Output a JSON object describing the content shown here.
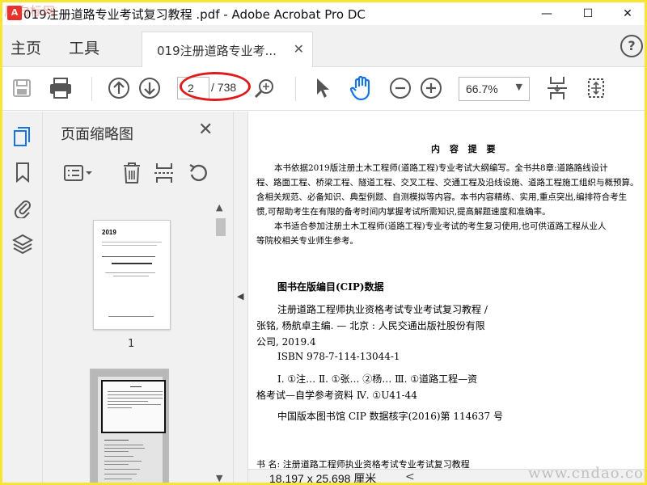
{
  "window": {
    "title": "019注册道路专业考试复习教程 .pdf - Adobe Acrobat Pro DC",
    "logo_watermark": "风向标网",
    "minimize": "—",
    "maximize": "☐",
    "close": "✕"
  },
  "nav": {
    "home": "主页",
    "tools": "工具",
    "tab_label": "019注册道路专业考...",
    "tab_close": "✕",
    "help": "?"
  },
  "toolbar": {
    "current_page": "2",
    "total_pages": "/ 738",
    "zoom": "66.7%",
    "zoom_caret": "▼"
  },
  "thumbnail_panel": {
    "title": "页面缩略图",
    "close": "✕",
    "thumbnails": [
      {
        "page_label": "1",
        "year": "2019"
      },
      {
        "page_label": "",
        "selected": true
      }
    ]
  },
  "document": {
    "heading": "内 容 提 要",
    "summary_lines": [
      "本书依据2019版注册土木工程师(道路工程)专业考试大纲编写。全书共8章:道路路线设计",
      "程、路面工程、桥梁工程、隧道工程、交叉工程、交通工程及沿线设施、道路工程施工组织与概预算。",
      "含相关规范、必备知识、典型例题、自测模拟等内容。本书内容精练、实用,重点突出,编排符合考生",
      "惯,可帮助考生在有限的备考时间内掌握考试所需知识,提高解题速度和准确率。",
      "本书适合参加注册土木工程师(道路工程)专业考试的考生复习使用,也可供道路工程从业人",
      "等院校相关专业师生参考。"
    ],
    "cip_title": "图书在版编目(CIP)数据",
    "cip_lines": [
      "注册道路工程师执业资格考试专业考试复习教程 /",
      "张铭, 杨航卓主编. — 北京 : 人民交通出版社股份有限",
      "公司, 2019.4",
      "ISBN  978-7-114-13044-1",
      "Ⅰ. ①注…    Ⅱ. ①张…  ②杨…    Ⅲ. ①道路工程—资",
      "格考试—自学参考资料    Ⅳ. ①U41-44",
      "中国版本图书馆 CIP 数据核字(2016)第 114637 号"
    ],
    "bottom_line": "书    名: 注册道路工程师执业资格考试专业考试复习教程"
  },
  "status": {
    "dimensions": "18.197 x 25.698 厘米",
    "arrow": "<",
    "watermark": "www.cndao.com"
  },
  "colors": {
    "highlight_oval": "#e01b1b",
    "active_hand": "#1473e6",
    "frame": "#f6e633"
  }
}
